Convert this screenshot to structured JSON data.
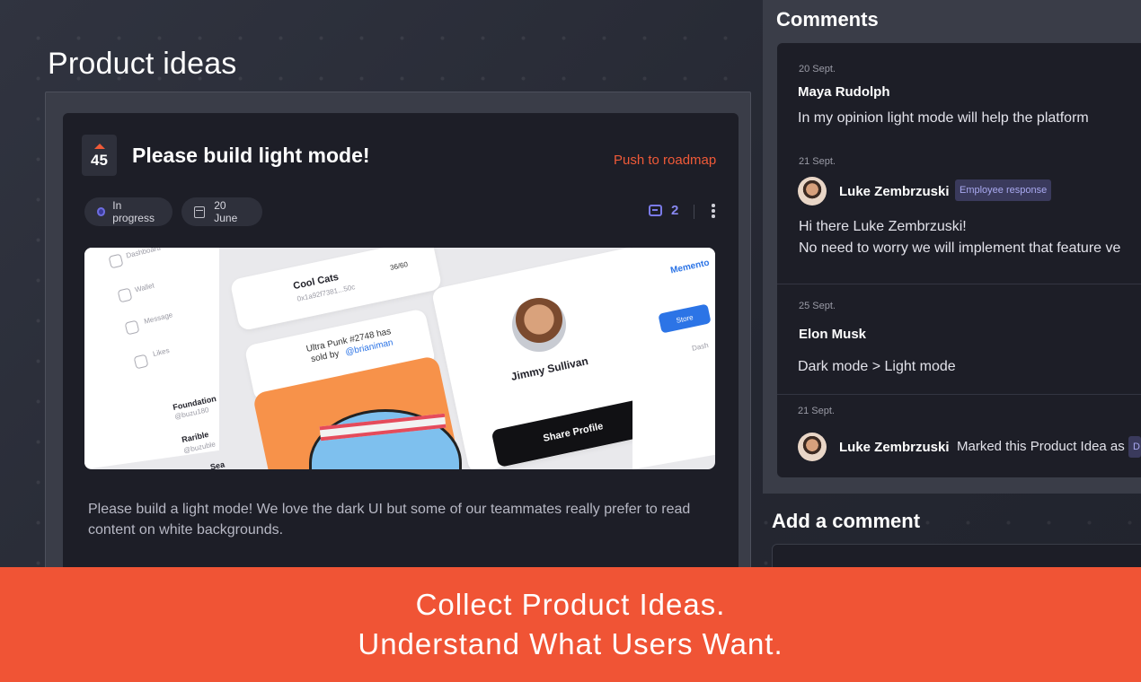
{
  "page": {
    "title": "Product ideas"
  },
  "idea": {
    "votes": "45",
    "title": "Please build light mode!",
    "push_label": "Push to roadmap",
    "status": "In progress",
    "date": "20 June",
    "comment_count": "2",
    "description": "Please build a light mode!  We love the dark UI but some of our teammates really prefer to read content on white backgrounds.",
    "preview": {
      "sidebar": [
        "Dashboard",
        "Wallet",
        "Message",
        "Likes"
      ],
      "lists": [
        {
          "name": "Foundation",
          "handle": "@buzu180"
        },
        {
          "name": "Rarible",
          "handle": "@buzuble"
        },
        {
          "name": "Sea",
          "handle": ""
        }
      ],
      "collection": {
        "name": "Cool Cats",
        "address": "0x1a92f7381...50c",
        "progress": "36/60"
      },
      "activity": {
        "text": "Ultra Punk #2748 has",
        "text2": "sold by",
        "user": "@brianiman"
      },
      "profile": {
        "name": "Jimmy Sullivan",
        "share": "Share Profile"
      },
      "right": {
        "brand": "Memento",
        "store": "Store",
        "dash": "Dash"
      }
    }
  },
  "comments": {
    "title": "Comments",
    "items": [
      {
        "date": "20 Sept.",
        "author": "Maya Rudolph",
        "text": "In my opinion light mode will help the platform"
      },
      {
        "date": "21 Sept.",
        "author": "Luke Zembrzuski",
        "badge": "Employee response",
        "text": "Hi there Luke Zembrzuski!",
        "text2": "No need to worry we will implement that feature ve"
      },
      {
        "date": "25 Sept.",
        "author": "Elon Musk",
        "text": "Dark mode > Light mode"
      },
      {
        "date": "21 Sept.",
        "author": "Luke Zembrzuski",
        "text": "Marked this Product Idea as",
        "badge": "D"
      }
    ]
  },
  "add_comment": {
    "title": "Add a comment"
  },
  "banner": {
    "line1": "Collect Product Ideas.",
    "line2": "Understand What Users Want."
  },
  "colors": {
    "accent": "#f05435",
    "background": "#2a2d38",
    "card": "#1d1e27",
    "badge_text": "#a9a9f0"
  },
  "icons": [
    "upvote-arrow-icon",
    "status-dot-icon",
    "calendar-icon",
    "comment-icon",
    "kebab-menu-icon"
  ]
}
